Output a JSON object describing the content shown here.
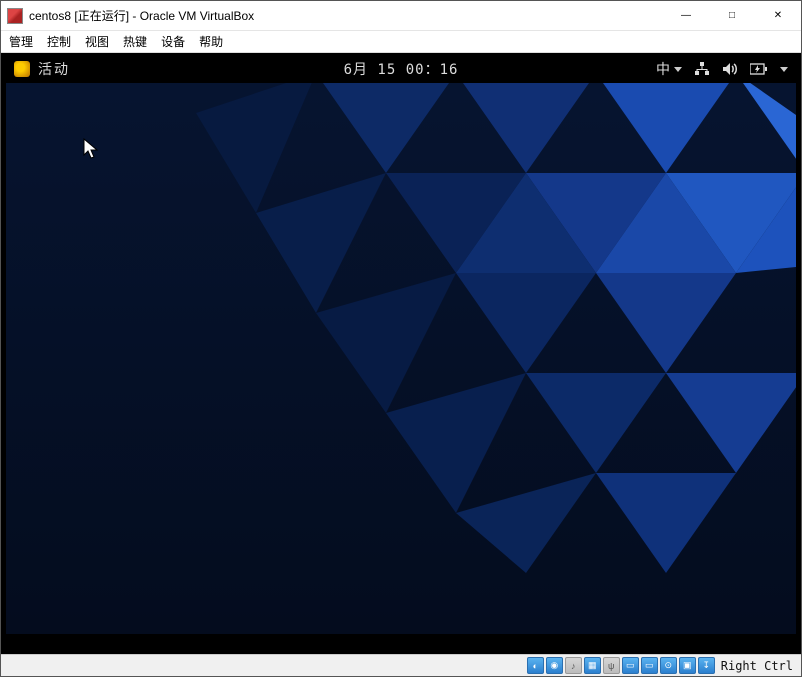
{
  "window": {
    "title": "centos8 [正在运行] - Oracle VM VirtualBox",
    "controls": {
      "min": "—",
      "max": "□",
      "close": "✕"
    }
  },
  "menubar": [
    "管理",
    "控制",
    "视图",
    "热键",
    "设备",
    "帮助"
  ],
  "gnome": {
    "activities": "活动",
    "datetime": "6月 15 00：16",
    "ime": "中"
  },
  "statusbar": {
    "hostkey": "Right Ctrl"
  }
}
